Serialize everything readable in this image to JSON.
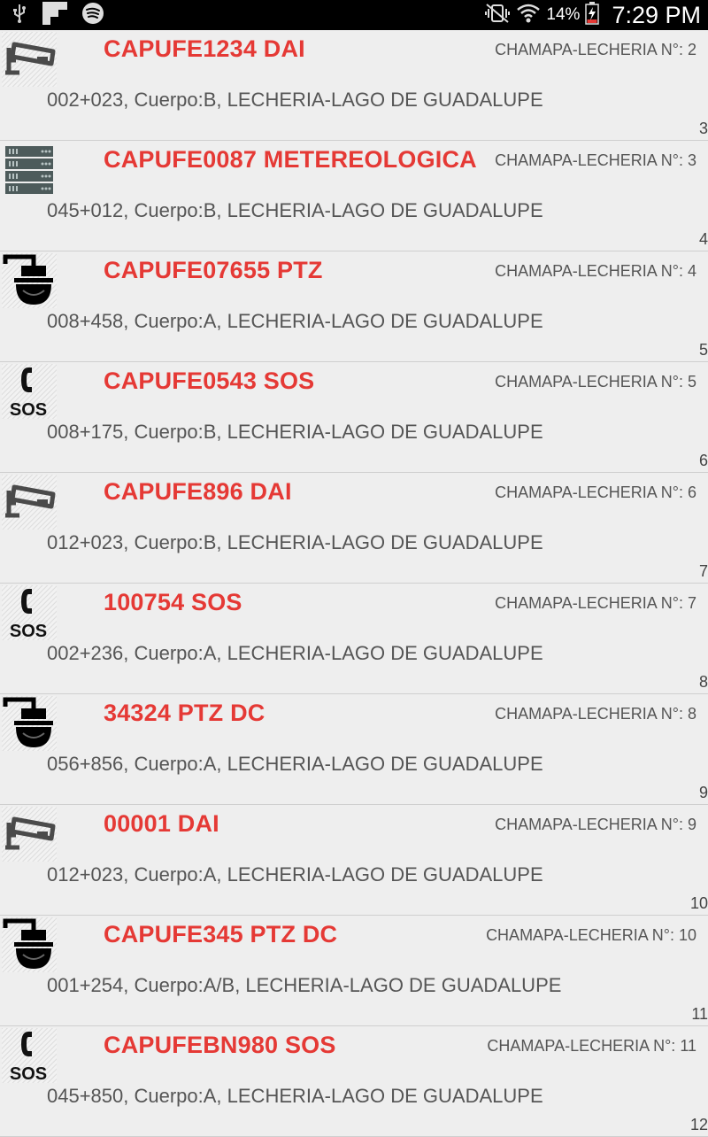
{
  "status_bar": {
    "battery_percent": "14%",
    "time": "7:29 PM"
  },
  "items": [
    {
      "icon": "dai-camera-icon",
      "title": "CAPUFE1234 DAI",
      "location": "CHAMAPA-LECHERIA N°: 2",
      "address": "002+023, Cuerpo:B, LECHERIA-LAGO DE GUADALUPE",
      "count": "3"
    },
    {
      "icon": "server-icon",
      "title": "CAPUFE0087 METEREOLOGICA",
      "location": "CHAMAPA-LECHERIA N°: 3",
      "address": "045+012, Cuerpo:B, LECHERIA-LAGO DE GUADALUPE",
      "count": "4"
    },
    {
      "icon": "ptz-camera-icon",
      "title": "CAPUFE07655 PTZ",
      "location": "CHAMAPA-LECHERIA N°: 4",
      "address": "008+458, Cuerpo:A, LECHERIA-LAGO DE GUADALUPE",
      "count": "5"
    },
    {
      "icon": "sos-phone-icon",
      "title": "CAPUFE0543 SOS",
      "location": "CHAMAPA-LECHERIA N°: 5",
      "address": "008+175, Cuerpo:B, LECHERIA-LAGO DE GUADALUPE",
      "count": "6"
    },
    {
      "icon": "dai-camera-icon",
      "title": "CAPUFE896 DAI",
      "location": "CHAMAPA-LECHERIA N°: 6",
      "address": "012+023, Cuerpo:B, LECHERIA-LAGO DE GUADALUPE",
      "count": "7"
    },
    {
      "icon": "sos-phone-icon",
      "title": "100754 SOS",
      "location": "CHAMAPA-LECHERIA N°: 7",
      "address": "002+236, Cuerpo:A, LECHERIA-LAGO DE GUADALUPE",
      "count": "8"
    },
    {
      "icon": "ptz-camera-icon",
      "title": "34324 PTZ DC",
      "location": "CHAMAPA-LECHERIA N°: 8",
      "address": "056+856, Cuerpo:A, LECHERIA-LAGO DE GUADALUPE",
      "count": "9"
    },
    {
      "icon": "dai-camera-icon",
      "title": "00001 DAI",
      "location": "CHAMAPA-LECHERIA N°: 9",
      "address": "012+023, Cuerpo:A, LECHERIA-LAGO DE GUADALUPE",
      "count": "10"
    },
    {
      "icon": "ptz-camera-icon",
      "title": "CAPUFE345 PTZ DC",
      "location": "CHAMAPA-LECHERIA N°: 10",
      "address": "001+254, Cuerpo:A/B, LECHERIA-LAGO DE GUADALUPE",
      "count": "11"
    },
    {
      "icon": "sos-phone-icon",
      "title": "CAPUFEBN980 SOS",
      "location": "CHAMAPA-LECHERIA N°: 11",
      "address": "045+850, Cuerpo:A, LECHERIA-LAGO DE GUADALUPE",
      "count": "12"
    }
  ],
  "colors": {
    "title_red": "#e53935",
    "background": "#eeeeee",
    "status_bar": "#000000"
  }
}
